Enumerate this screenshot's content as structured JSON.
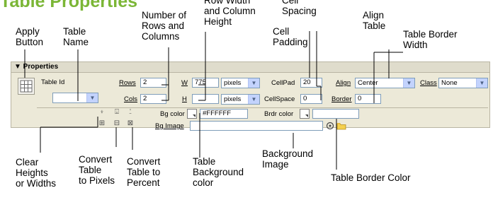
{
  "title": "Table Properties",
  "callouts": {
    "apply_button": "Apply\nButton",
    "table_name": "Table\nName",
    "rows_columns": "Number of\nRows and\nColumns",
    "row_width_height": "Row Width\nand Column\nHeight",
    "cell_spacing": "Cell\nSpacing",
    "cell_padding": "Cell\nPadding",
    "align_table": "Align\nTable",
    "table_border_width": "Table Border\nWidth",
    "clear_heights": "Clear\nHeights\nor Widths",
    "convert_pixels": "Convert\nTable\nto Pixels",
    "convert_percent": "Convert\nTable to\nPercent",
    "table_bg_color": "Table\nBackground\ncolor",
    "background_image": "Background\nImage",
    "table_border_color": "Table Border Color"
  },
  "panel": {
    "title": "▼ Properties",
    "table_id_label": "Table Id",
    "table_id_value": "",
    "rows_label": "Rows",
    "rows_value": "2",
    "cols_label": "Cols",
    "cols_value": "2",
    "w_label": "W",
    "w_value": "775",
    "w_unit": "pixels",
    "h_label": "H",
    "h_value": "",
    "h_unit": "pixels",
    "cellpad_label": "CellPad",
    "cellpad_value": "20",
    "cellspace_label": "CellSpace",
    "cellspace_value": "0",
    "align_label": "Align",
    "align_value": "Center",
    "border_label": "Border",
    "border_value": "0",
    "class_label": "Class",
    "class_value": "None",
    "bg_color_label": "Bg color",
    "bg_color_value": "#FFFFFF",
    "brdr_color_label": "Brdr color",
    "brdr_color_value": "",
    "bg_image_label": "Bg Image",
    "bg_image_value": ""
  },
  "icons": {
    "apply": "table-grid-icon",
    "clear_row_heights": "clear-row-heights-icon",
    "clear_col_widths_a": "clear-column-widths-icon",
    "clear_col_widths_b": "clear-column-widths-percent-icon",
    "convert_heights_px": "convert-heights-to-pixels-icon",
    "convert_widths_px": "convert-widths-to-pixels-icon",
    "convert_widths_pct": "convert-widths-to-percent-icon",
    "point_to_file": "point-to-file-icon",
    "browse_folder": "folder-icon"
  },
  "colors": {
    "title_green": "#7bb636",
    "panel_bg": "#ece9d8",
    "dropdown_blue": "#c3d3fd",
    "folder_yellow": "#f4d04f"
  }
}
